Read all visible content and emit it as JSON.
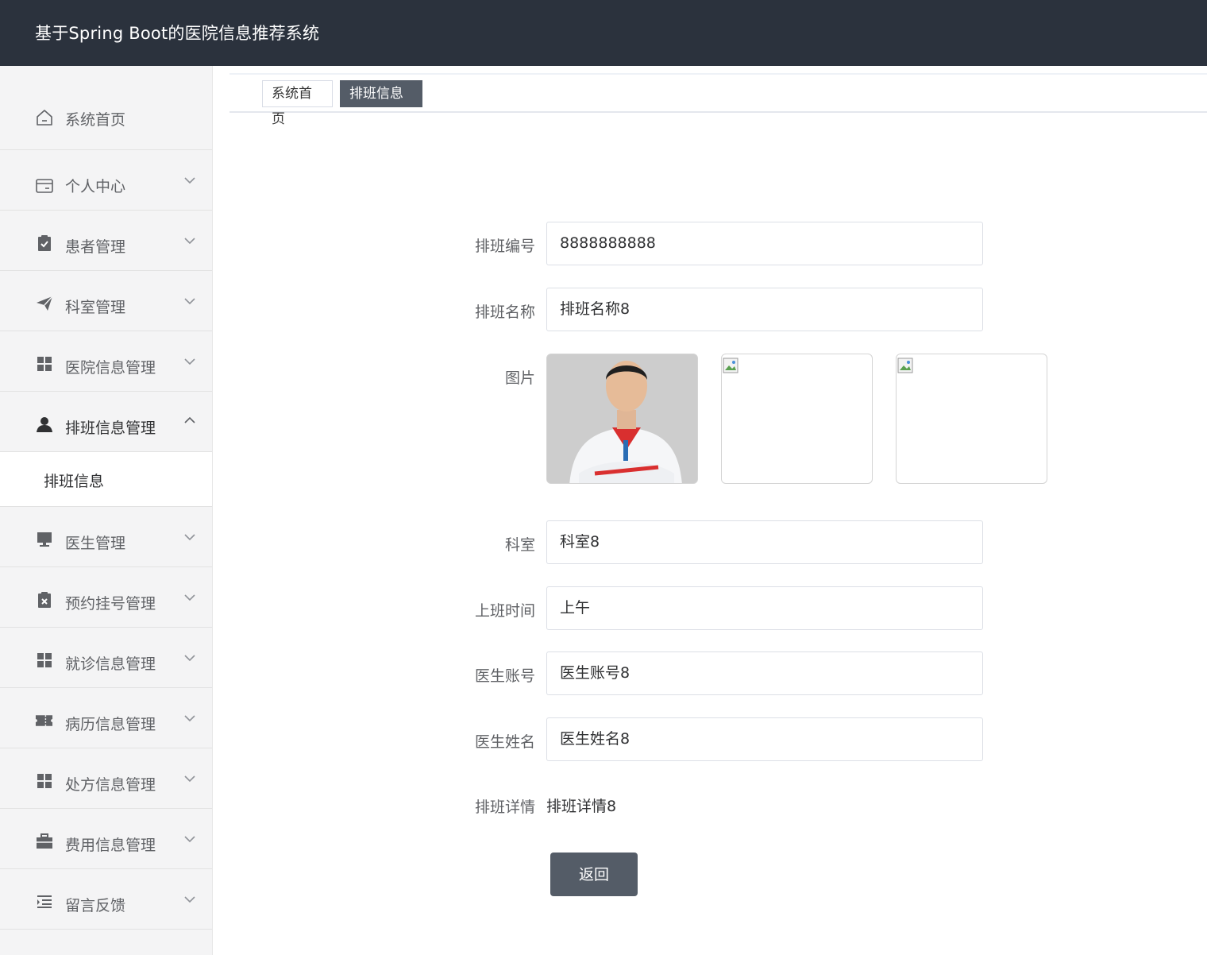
{
  "app": {
    "title": "基于Spring Boot的医院信息推荐系统"
  },
  "sidebar": {
    "items": [
      {
        "label": "系统首页",
        "icon": "home-icon"
      },
      {
        "label": "个人中心",
        "icon": "wallet-icon"
      },
      {
        "label": "患者管理",
        "icon": "clipboard-check-icon"
      },
      {
        "label": "科室管理",
        "icon": "paper-plane-icon"
      },
      {
        "label": "医院信息管理",
        "icon": "grid-icon"
      },
      {
        "label": "排班信息管理",
        "icon": "user-icon",
        "expanded": true,
        "children": [
          {
            "label": "排班信息"
          }
        ]
      },
      {
        "label": "医生管理",
        "icon": "monitor-icon"
      },
      {
        "label": "预约挂号管理",
        "icon": "clipboard-x-icon"
      },
      {
        "label": "就诊信息管理",
        "icon": "grid-icon"
      },
      {
        "label": "病历信息管理",
        "icon": "ticket-icon"
      },
      {
        "label": "处方信息管理",
        "icon": "grid-icon"
      },
      {
        "label": "费用信息管理",
        "icon": "briefcase-icon"
      },
      {
        "label": "留言反馈",
        "icon": "list-indent-icon"
      }
    ]
  },
  "tabs": [
    {
      "label": "系统首页"
    },
    {
      "label": "排班信息",
      "close": "✕",
      "active": true
    }
  ],
  "form": {
    "schedule_no": {
      "label": "排班编号",
      "value": "8888888888"
    },
    "schedule_name": {
      "label": "排班名称",
      "value": "排班名称8"
    },
    "images": {
      "label": "图片"
    },
    "department": {
      "label": "科室",
      "value": "科室8"
    },
    "shift_time": {
      "label": "上班时间",
      "value": "上午"
    },
    "doctor_account": {
      "label": "医生账号",
      "value": "医生账号8"
    },
    "doctor_name": {
      "label": "医生姓名",
      "value": "医生姓名8"
    },
    "detail": {
      "label": "排班详情",
      "value": "排班详情8"
    },
    "back_label": "返回"
  },
  "colors": {
    "topbar": "#2b323d",
    "accent": "#545c67",
    "sidebar_bg": "#f4f4f5"
  }
}
